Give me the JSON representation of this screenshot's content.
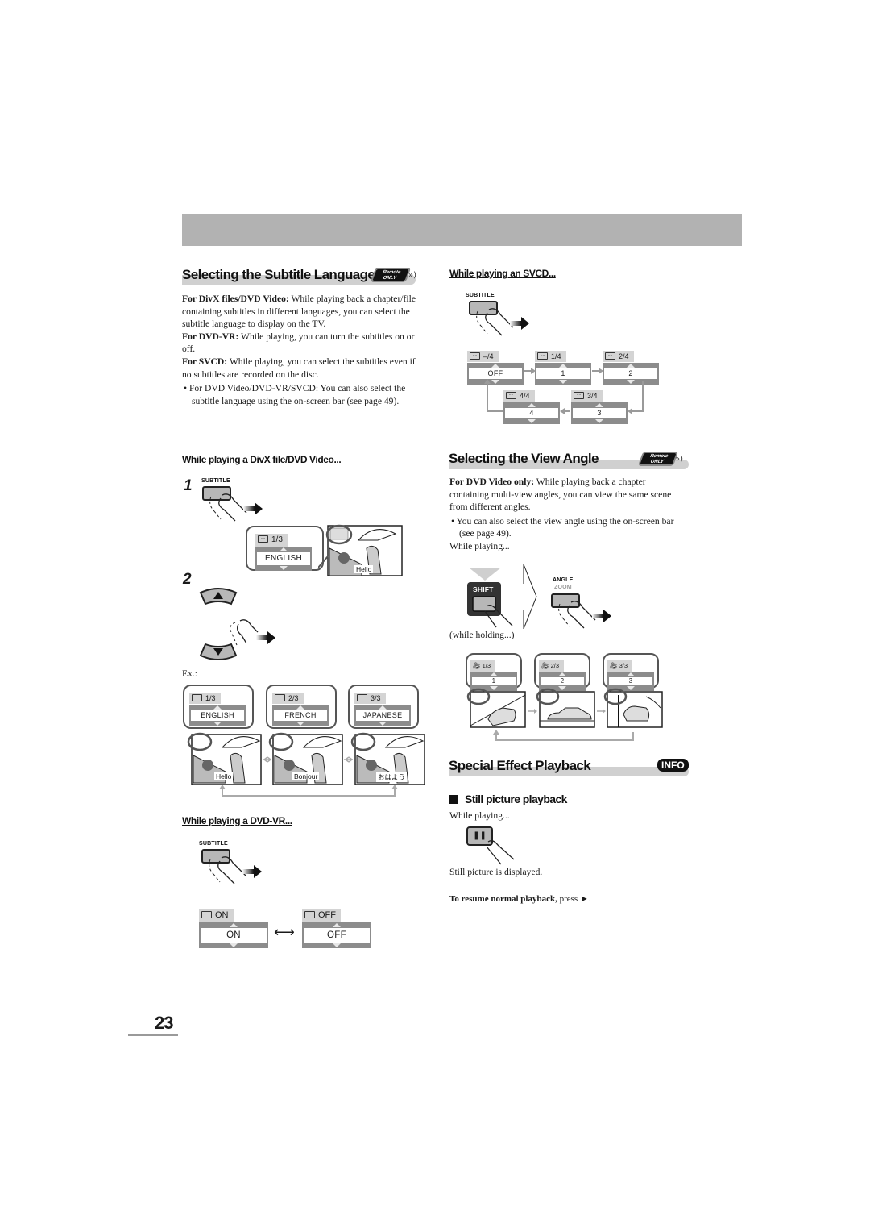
{
  "page": {
    "number": "23",
    "colors": {
      "header_band": "#b2b2b2",
      "section_bar": "#d0d0d0",
      "osd_frame": "#8c8c8c"
    }
  },
  "subtitle_section": {
    "title": "Selecting the Subtitle Language",
    "badge": {
      "line1": "Remote",
      "line2": "ONLY"
    },
    "paragraphs": [
      {
        "lead": "For DivX files/DVD Video:",
        "text": " While playing back a chapter/file containing subtitles in different languages, you can select the subtitle language to display on the TV."
      },
      {
        "lead": "For DVD-VR:",
        "text": " While playing, you can turn the subtitles on or off."
      },
      {
        "lead": "For SVCD:",
        "text": " While playing, you can select the subtitles even if no subtitles are recorded on the disc."
      }
    ],
    "bullet": "For DVD Video/DVD-VR/SVCD: You can also select the subtitle language using the on-screen bar (see page 49).",
    "divx": {
      "heading": "While playing a DivX file/DVD Video...",
      "step1": "1",
      "step2": "2",
      "button_label": "SUBTITLE",
      "step1_osd": {
        "tab": "1/3",
        "value": "ENGLISH",
        "caption": "Hello"
      },
      "up_icon": "▲",
      "down_icon": "▼",
      "example_label": "Ex.:",
      "examples": [
        {
          "tab": "1/3",
          "value": "ENGLISH",
          "caption": "Hello"
        },
        {
          "tab": "2/3",
          "value": "FRENCH",
          "caption": "Bonjour"
        },
        {
          "tab": "3/3",
          "value": "JAPANESE",
          "caption": "おはよう"
        }
      ]
    },
    "dvdvr": {
      "heading": "While playing a DVD-VR...",
      "button_label": "SUBTITLE",
      "states": [
        {
          "tab": "ON",
          "value": "ON"
        },
        {
          "tab": "OFF",
          "value": "OFF"
        }
      ],
      "toggle_icon": "⟷"
    }
  },
  "svcd": {
    "heading": "While playing an SVCD...",
    "button_label": "SUBTITLE",
    "osds": [
      {
        "tab": "–/4",
        "value": "OFF"
      },
      {
        "tab": "1/4",
        "value": "1"
      },
      {
        "tab": "2/4",
        "value": "2"
      },
      {
        "tab": "3/4",
        "value": "3"
      },
      {
        "tab": "4/4",
        "value": "4"
      }
    ]
  },
  "angle_section": {
    "title": "Selecting the View Angle",
    "badge": {
      "line1": "Remote",
      "line2": "ONLY"
    },
    "lead": "For DVD Video only:",
    "text": " While playing back a chapter containing multi-view angles, you can view the same scene from different angles.",
    "bullet": "You can also select the view angle using the on-screen bar (see page 49).",
    "while_playing": "While playing...",
    "shift_label": "SHIFT",
    "angle_label": "ANGLE",
    "zoom_label": "ZOOM",
    "while_holding": "(while holding...)",
    "osds": [
      {
        "tab": "1/3",
        "value": "1"
      },
      {
        "tab": "2/3",
        "value": "2"
      },
      {
        "tab": "3/3",
        "value": "3"
      }
    ]
  },
  "special_section": {
    "title": "Special Effect Playback",
    "info_badge": "INFO",
    "subheading": "Still picture playback",
    "while_playing": "While playing...",
    "pause_icon": "❚❚",
    "result": "Still picture is displayed.",
    "resume_lead": "To resume normal playback,",
    "resume_text": " press ►."
  }
}
